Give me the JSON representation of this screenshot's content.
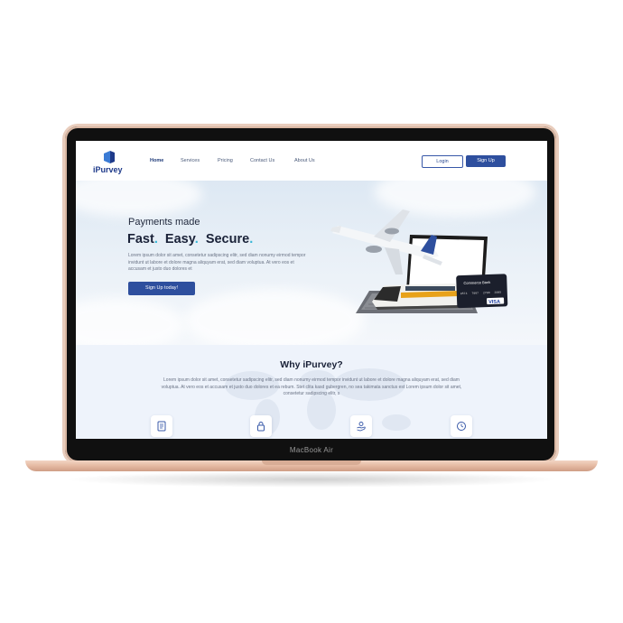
{
  "device": {
    "label": "MacBook Air"
  },
  "site": {
    "logo_text": "iPurvey",
    "nav": [
      {
        "label": "Home",
        "active": true
      },
      {
        "label": "Services"
      },
      {
        "label": "Pricing"
      },
      {
        "label": "Contact Us"
      },
      {
        "label": "About Us"
      }
    ],
    "login_label": "Login",
    "signup_label": "Sign Up",
    "brand_color": "#2e4f9e",
    "accent_color": "#38b6d6"
  },
  "hero": {
    "subtitle": "Payments made",
    "headline_words": [
      "Fast",
      "Easy",
      "Secure"
    ],
    "description": "Lorem ipsum dolor sit amet, consetetur sadipscing elitr, sed diam nonumy eirmod tempor invidunt ut labore et dolore magna aliquyam erat, sed diam voluptua. At vero eos et accusam et justo duo dolores et",
    "cta_label": "Sign Up  today!",
    "card_text": {
      "bank": "Commerce Bank",
      "number": [
        "0574",
        "7007",
        "2700",
        "2005"
      ],
      "network": "VISA"
    }
  },
  "why": {
    "title": "Why iPurvey?",
    "description": "Lorem ipsum dolor sit amet, consetetur sadipscing elitr, sed diam nonumy eirmod tempor invidunt ut labore et dolore magna aliquyam erat, sed diam voluptua. At vero eos et accusam et justo duo dolores et ea rebum. Stet clita kasd gubergren, no sea takimata sanctus est Lorem ipsum dolor sit amet, consetetur sadipscing elitr, s",
    "features": [
      {
        "icon": "document-icon"
      },
      {
        "icon": "lock-icon"
      },
      {
        "icon": "hand-coin-icon"
      },
      {
        "icon": "clock-icon"
      }
    ]
  }
}
